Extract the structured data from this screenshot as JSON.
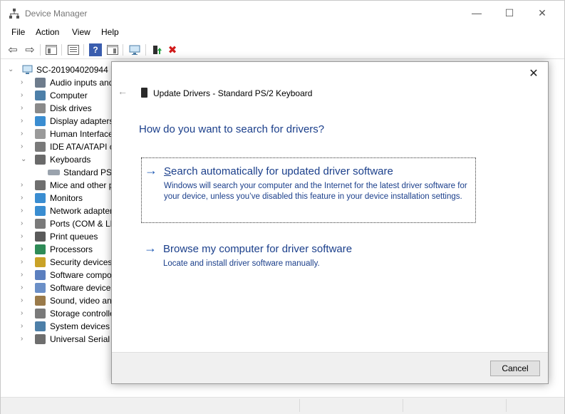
{
  "window": {
    "title": "Device Manager",
    "minimize_glyph": "—",
    "maximize_glyph": "☐",
    "close_glyph": "✕"
  },
  "menu": [
    "File",
    "Action",
    "View",
    "Help"
  ],
  "toolbar": {
    "icons": [
      "back-arrow-icon",
      "forward-arrow-icon",
      "show-hide-console-tree-icon",
      "properties-icon",
      "help-icon",
      "action-pane-icon",
      "monitor-icon",
      "update-driver-icon",
      "uninstall-device-icon"
    ],
    "back_glyph": "⇦",
    "forward_glyph": "⇨",
    "help_glyph": "?",
    "uninstall_glyph": "✖"
  },
  "tree": {
    "root": "SC-201904020944",
    "items": [
      {
        "label": "Audio inputs and",
        "expanded": false
      },
      {
        "label": "Computer",
        "expanded": false
      },
      {
        "label": "Disk drives",
        "expanded": false
      },
      {
        "label": "Display adapters",
        "expanded": false
      },
      {
        "label": "Human Interface",
        "expanded": false
      },
      {
        "label": "IDE ATA/ATAPI c",
        "expanded": false
      },
      {
        "label": "Keyboards",
        "expanded": true
      },
      {
        "label": "Standard PS/",
        "child": true
      },
      {
        "label": "Mice and other p",
        "expanded": false
      },
      {
        "label": "Monitors",
        "expanded": false
      },
      {
        "label": "Network adapter",
        "expanded": false
      },
      {
        "label": "Ports (COM & LP",
        "expanded": false
      },
      {
        "label": "Print queues",
        "expanded": false
      },
      {
        "label": "Processors",
        "expanded": false
      },
      {
        "label": "Security devices",
        "expanded": false
      },
      {
        "label": "Software compo",
        "expanded": false
      },
      {
        "label": "Software devices",
        "expanded": false
      },
      {
        "label": "Sound, video and",
        "expanded": false
      },
      {
        "label": "Storage controlle",
        "expanded": false
      },
      {
        "label": "System devices",
        "expanded": false
      },
      {
        "label": "Universal Serial B",
        "expanded": false
      }
    ],
    "expanded_glyph": "⌄",
    "collapsed_glyph": "›",
    "root_glyph": "⌄"
  },
  "dialog": {
    "close_glyph": "✕",
    "back_glyph": "←",
    "header": "Update Drivers - Standard PS/2 Keyboard",
    "question": "How do you want to search for drivers?",
    "auto": {
      "arrow": "→",
      "title": "Search automatically for updated driver software",
      "description": "Windows will search your computer and the Internet for the latest driver software for your device, unless you’ve disabled this feature in your device installation settings."
    },
    "browse": {
      "arrow": "→",
      "title": "Browse my computer for driver software",
      "description": "Locate and install driver software manually."
    },
    "cancel_label": "Cancel"
  },
  "colors": {
    "link_blue": "#1b3f8b",
    "arrow_blue": "#1b57b3",
    "uninstall_red": "#d11b1b"
  }
}
